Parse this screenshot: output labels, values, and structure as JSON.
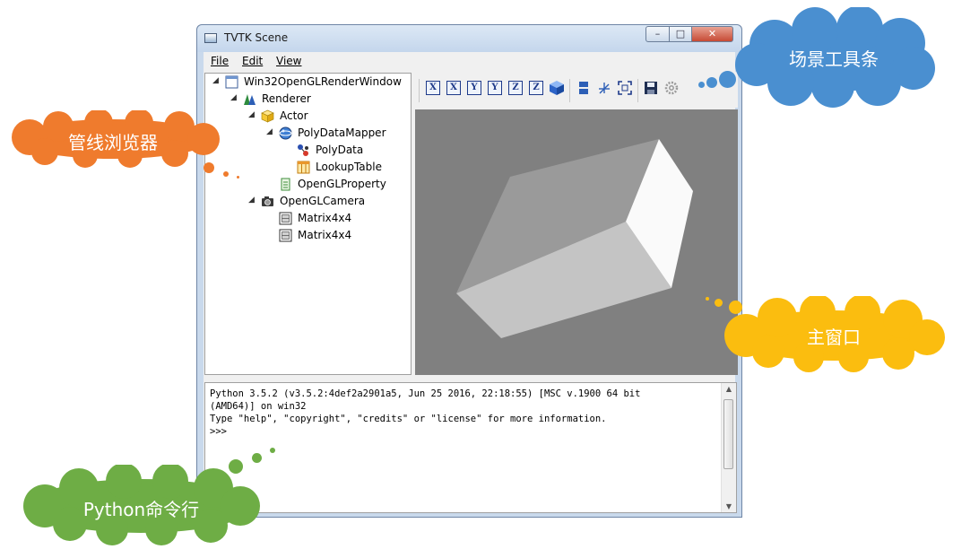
{
  "window": {
    "title": "TVTK Scene",
    "controls": {
      "minimize": "–",
      "maximize": "□",
      "close": "✕"
    }
  },
  "menu": [
    "File",
    "Edit",
    "View"
  ],
  "tree": [
    {
      "label": "Win32OpenGLRenderWindow",
      "icon": "window-icon",
      "level": 0,
      "expanded": true
    },
    {
      "label": "Renderer",
      "icon": "renderer-icon",
      "level": 1,
      "expanded": true
    },
    {
      "label": "Actor",
      "icon": "cube-icon",
      "level": 2,
      "expanded": true
    },
    {
      "label": "PolyDataMapper",
      "icon": "mapper-icon",
      "level": 3,
      "expanded": true
    },
    {
      "label": "PolyData",
      "icon": "polydata-icon",
      "level": 4,
      "expanded": null
    },
    {
      "label": "LookupTable",
      "icon": "table-icon",
      "level": 4,
      "expanded": null
    },
    {
      "label": "OpenGLProperty",
      "icon": "property-icon",
      "level": 3,
      "expanded": null
    },
    {
      "label": "OpenGLCamera",
      "icon": "camera-icon",
      "level": 2,
      "expanded": true
    },
    {
      "label": "Matrix4x4",
      "icon": "matrix-icon",
      "level": 3,
      "expanded": null
    },
    {
      "label": "Matrix4x4",
      "icon": "matrix-icon",
      "level": 3,
      "expanded": null
    }
  ],
  "toolbar": {
    "axis_buttons": [
      "X",
      "X",
      "Y",
      "Y",
      "Z",
      "Z"
    ],
    "other_icons": [
      "isometric-icon",
      "parallel-projection-icon",
      "axes-icon",
      "fullscreen-icon",
      "save-icon",
      "settings-icon"
    ]
  },
  "console": {
    "lines": [
      "Python 3.5.2 (v3.5.2:4def2a2901a5, Jun 25 2016, 22:18:55) [MSC v.1900 64 bit",
      "(AMD64)] on win32",
      "Type \"help\", \"copyright\", \"credits\" or \"license\" for more information.",
      ">>>"
    ]
  },
  "callouts": {
    "toolbar": "场景工具条",
    "pipeline": "管线浏览器",
    "main_window": "主窗口",
    "python": "Python命令行"
  },
  "colors": {
    "toolbar_callout": "#4a8fd0",
    "pipeline_callout": "#ef7b2d",
    "main_window_callout": "#fbbd0f",
    "python_callout": "#6ead45",
    "scene_bg": "#808080"
  }
}
